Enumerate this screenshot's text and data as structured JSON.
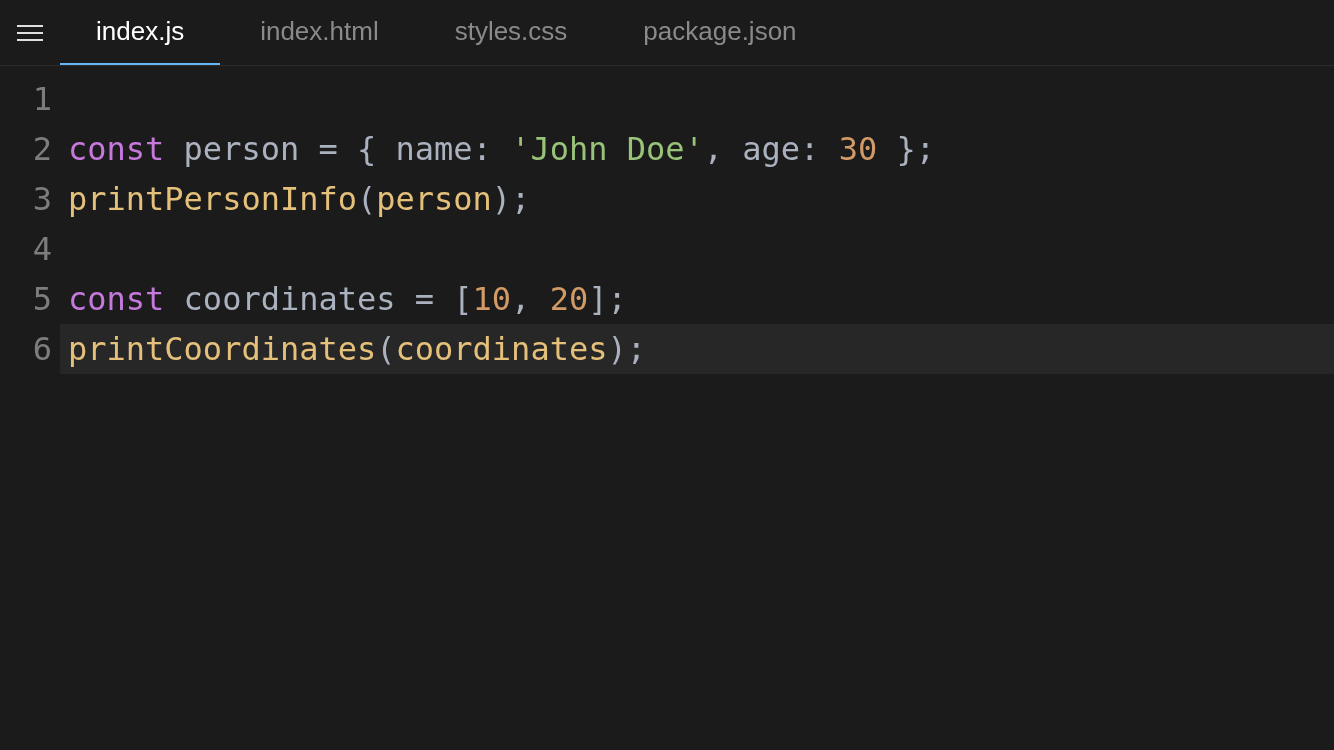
{
  "tabs": [
    {
      "label": "index.js",
      "selected": true
    },
    {
      "label": "index.html",
      "selected": false
    },
    {
      "label": "styles.css",
      "selected": false
    },
    {
      "label": "package.json",
      "selected": false
    }
  ],
  "editor": {
    "lines": [
      {
        "number": "1",
        "active": false
      },
      {
        "number": "2",
        "active": false,
        "tokens": [
          {
            "kind": "keyword",
            "text": "const"
          },
          {
            "kind": "plain",
            "text": " person = { name: "
          },
          {
            "kind": "string",
            "text": "'John Doe'"
          },
          {
            "kind": "plain",
            "text": ", age: "
          },
          {
            "kind": "number",
            "text": "30"
          },
          {
            "kind": "plain",
            "text": " };"
          }
        ]
      },
      {
        "number": "3",
        "active": false,
        "tokens": [
          {
            "kind": "function",
            "text": "printPersonInfo"
          },
          {
            "kind": "plain",
            "text": "("
          },
          {
            "kind": "function",
            "text": "person"
          },
          {
            "kind": "plain",
            "text": ");"
          }
        ]
      },
      {
        "number": "4",
        "active": false
      },
      {
        "number": "5",
        "active": false,
        "tokens": [
          {
            "kind": "keyword",
            "text": "const"
          },
          {
            "kind": "plain",
            "text": " coordinates = ["
          },
          {
            "kind": "number",
            "text": "10"
          },
          {
            "kind": "plain",
            "text": ", "
          },
          {
            "kind": "number",
            "text": "20"
          },
          {
            "kind": "plain",
            "text": "];"
          }
        ]
      },
      {
        "number": "6",
        "active": true,
        "tokens": [
          {
            "kind": "function",
            "text": "printCoordinates"
          },
          {
            "kind": "plain",
            "text": "("
          },
          {
            "kind": "function",
            "text": "coordinates"
          },
          {
            "kind": "plain",
            "text": ");"
          }
        ]
      }
    ]
  }
}
